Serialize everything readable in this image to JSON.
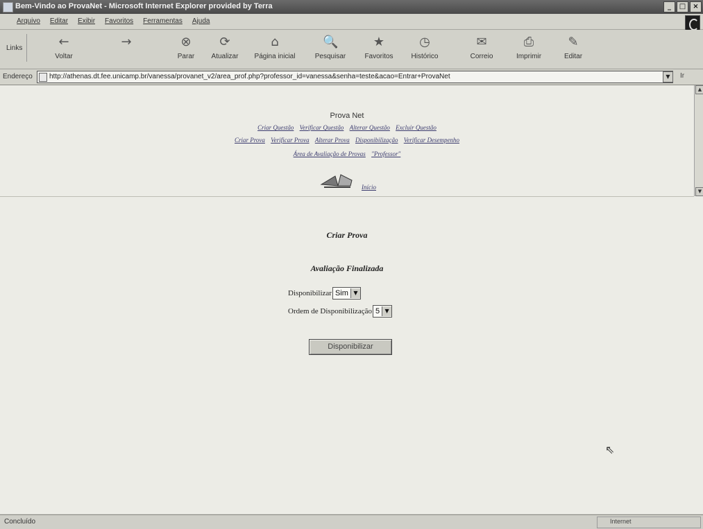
{
  "window": {
    "title": "Bem-Vindo ao ProvaNet - Microsoft Internet Explorer provided by Terra",
    "controls": [
      "_",
      "□",
      "×"
    ]
  },
  "menu": [
    "Arquivo",
    "Editar",
    "Exibir",
    "Favoritos",
    "Ferramentas",
    "Ajuda"
  ],
  "toolbar": {
    "links_label": "Links",
    "buttons": [
      {
        "label": "Voltar",
        "icon": "←"
      },
      {
        "label": "",
        "icon": "→"
      },
      {
        "label": "Parar",
        "icon": "⊗"
      },
      {
        "label": "Atualizar",
        "icon": "⟳"
      },
      {
        "label": "Página inicial",
        "icon": "⌂"
      },
      {
        "label": "Pesquisar",
        "icon": "🔍"
      },
      {
        "label": "Favoritos",
        "icon": "★"
      },
      {
        "label": "Histórico",
        "icon": "◷"
      },
      {
        "label": "Correio",
        "icon": "✉"
      },
      {
        "label": "Imprimir",
        "icon": "⎙"
      },
      {
        "label": "Editar",
        "icon": "✎"
      }
    ]
  },
  "address": {
    "label": "Endereço",
    "url": "http://athenas.dt.fee.unicamp.br/vanessa/provanet_v2/area_prof.php?professor_id=vanessa&senha=teste&acao=Entrar+ProvaNet",
    "go_label": "Ir"
  },
  "site": {
    "title": "Prova Net",
    "nav_row1": [
      "Criar Questão",
      "Verificar Questão",
      "Alterar Questão",
      "Excluir Questão"
    ],
    "nav_row2": [
      "Criar Prova",
      "Verificar Prova",
      "Alterar Prova",
      "Disponibilização",
      "Verificar Desempenho"
    ],
    "nav_row3": [
      "Área de Avaliação de Provas",
      "\"Professor\""
    ],
    "logo_link": "Início"
  },
  "form": {
    "heading": "Criar Prova",
    "subheading": "Avaliação Finalizada",
    "availability_label": "Disponibilizar",
    "availability_value": "Sim",
    "order_label": "Ordem de Disponibilização",
    "order_value": "5",
    "submit_label": "Disponibilizar"
  },
  "status": {
    "text": "Concluído",
    "zone": "Internet"
  }
}
